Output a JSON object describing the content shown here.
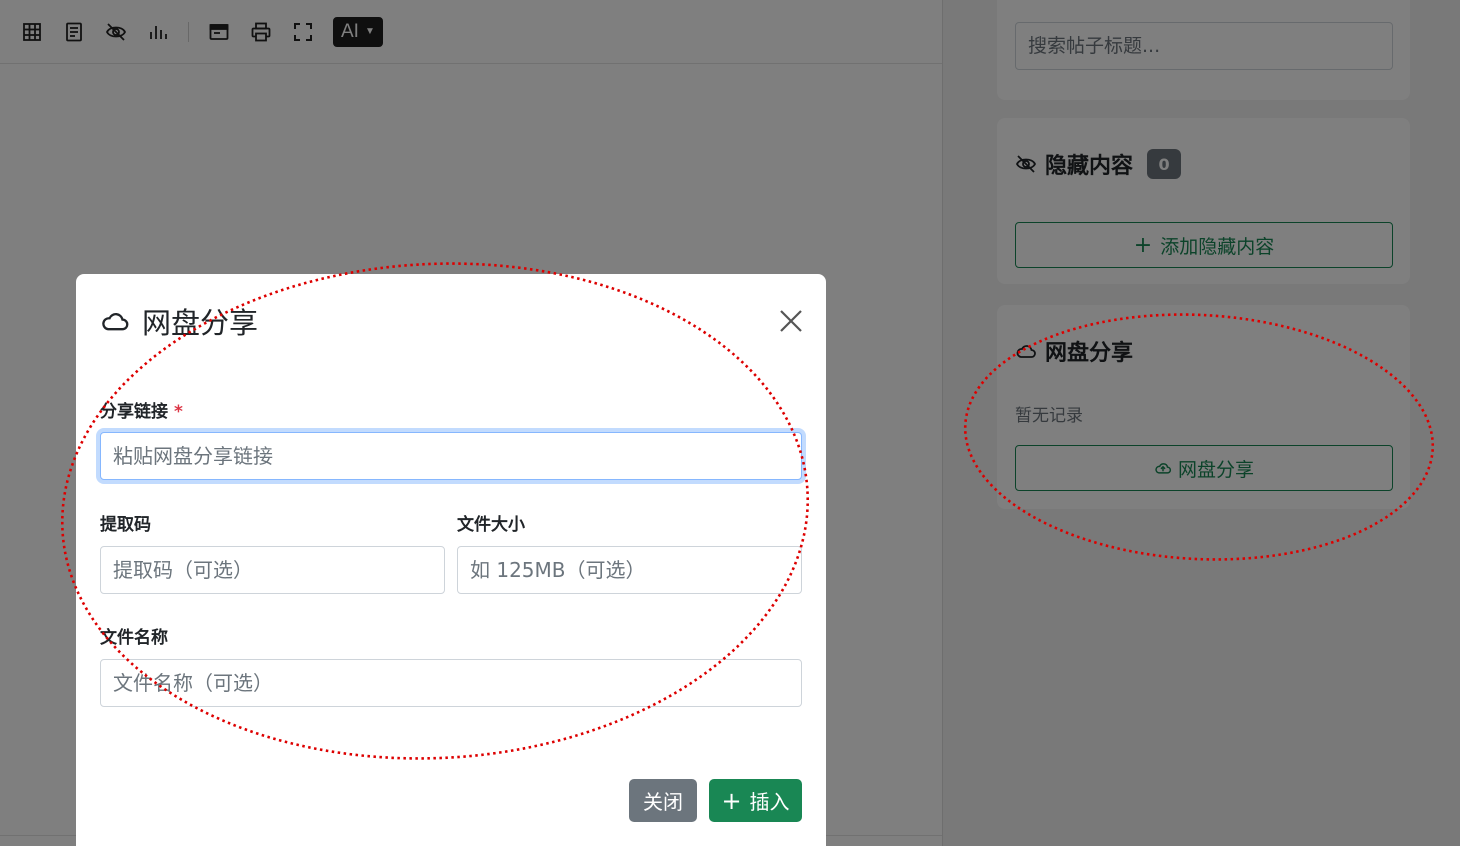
{
  "toolbar": {
    "icons": [
      "table-icon",
      "document-icon",
      "eye-off-icon",
      "chart-icon",
      "window-icon",
      "print-icon",
      "fullscreen-icon"
    ],
    "ai_label": "AI"
  },
  "sidebar": {
    "search": {
      "placeholder": "搜索帖子标题..."
    },
    "hidden_content": {
      "title": "隐藏内容",
      "count": "0",
      "add_button": "添加隐藏内容"
    },
    "pan_share": {
      "title": "网盘分享",
      "empty_text": "暂无记录",
      "button": "网盘分享"
    }
  },
  "modal": {
    "title": "网盘分享",
    "share_link": {
      "label": "分享链接",
      "required_mark": "*",
      "placeholder": "粘贴网盘分享链接"
    },
    "extract_code": {
      "label": "提取码",
      "placeholder": "提取码（可选）"
    },
    "file_size": {
      "label": "文件大小",
      "placeholder": "如 125MB（可选）"
    },
    "file_name": {
      "label": "文件名称",
      "placeholder": "文件名称（可选）"
    },
    "close_button": "关闭",
    "insert_button": "插入",
    "insert_plus": "+"
  },
  "colors": {
    "primary_green": "#198754",
    "secondary_gray": "#6c757d",
    "annotation_red": "#dd0000"
  }
}
